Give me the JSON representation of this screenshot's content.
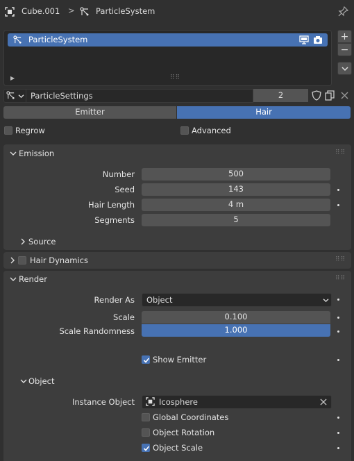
{
  "header": {
    "object_name": "Cube.001",
    "separator": ">",
    "system_name": "ParticleSystem"
  },
  "list": {
    "items": [
      {
        "label": "ParticleSystem"
      }
    ],
    "side_buttons": {
      "add": "+",
      "remove": "−",
      "menu": "⌄"
    }
  },
  "settings": {
    "name": "ParticleSettings",
    "users": "2"
  },
  "tabs": [
    {
      "label": "Emitter",
      "active": false
    },
    {
      "label": "Hair",
      "active": true
    }
  ],
  "options": {
    "regrow": {
      "label": "Regrow",
      "checked": false
    },
    "advanced": {
      "label": "Advanced",
      "checked": false
    }
  },
  "emission": {
    "title": "Emission",
    "fields": [
      {
        "label": "Number",
        "value": "500"
      },
      {
        "label": "Seed",
        "value": "143"
      },
      {
        "label": "Hair Length",
        "value": "4 m"
      },
      {
        "label": "Segments",
        "value": "5"
      }
    ],
    "source": "Source"
  },
  "hair_dynamics": {
    "title": "Hair Dynamics",
    "enabled": false
  },
  "render": {
    "title": "Render",
    "render_as": {
      "label": "Render As",
      "value": "Object"
    },
    "scale": {
      "label": "Scale",
      "value": "0.100"
    },
    "scale_randomness": {
      "label": "Scale Randomness",
      "value": "1.000"
    },
    "show_emitter": {
      "label": "Show Emitter",
      "checked": true
    },
    "object": {
      "title": "Object",
      "instance_object": {
        "label": "Instance Object",
        "value": "Icosphere"
      },
      "global_coordinates": {
        "label": "Global Coordinates",
        "checked": false
      },
      "object_rotation": {
        "label": "Object Rotation",
        "checked": false
      },
      "object_scale": {
        "label": "Object Scale",
        "checked": true
      }
    }
  },
  "colors": {
    "background": "#303030",
    "panel": "#3d3d3d",
    "field": "#545454",
    "accent": "#4772b3"
  }
}
